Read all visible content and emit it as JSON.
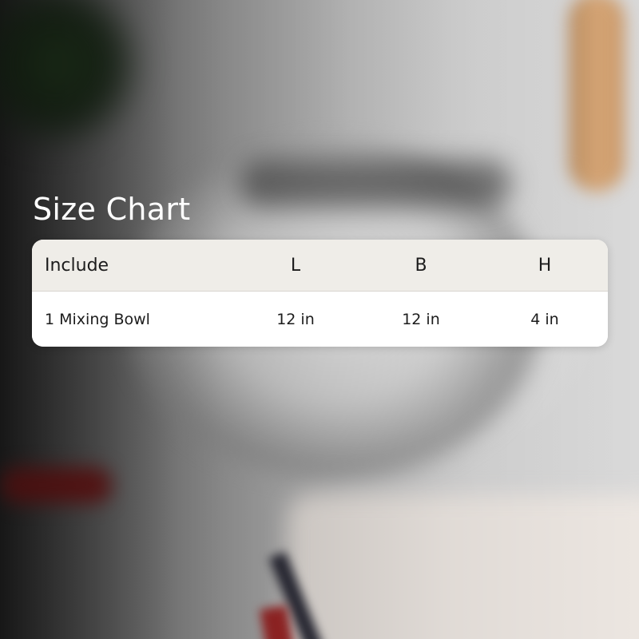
{
  "title": "Size Chart",
  "table": {
    "columns": [
      "Include",
      "L",
      "B",
      "H"
    ],
    "rows": [
      {
        "include": "1 Mixing Bowl",
        "l": "12 in",
        "b": "12 in",
        "h": "4 in"
      }
    ]
  },
  "colors": {
    "header_bg": "#efede8",
    "row_bg": "#ffffff",
    "title_text": "#ffffff",
    "table_text": "#1c1c1c"
  }
}
